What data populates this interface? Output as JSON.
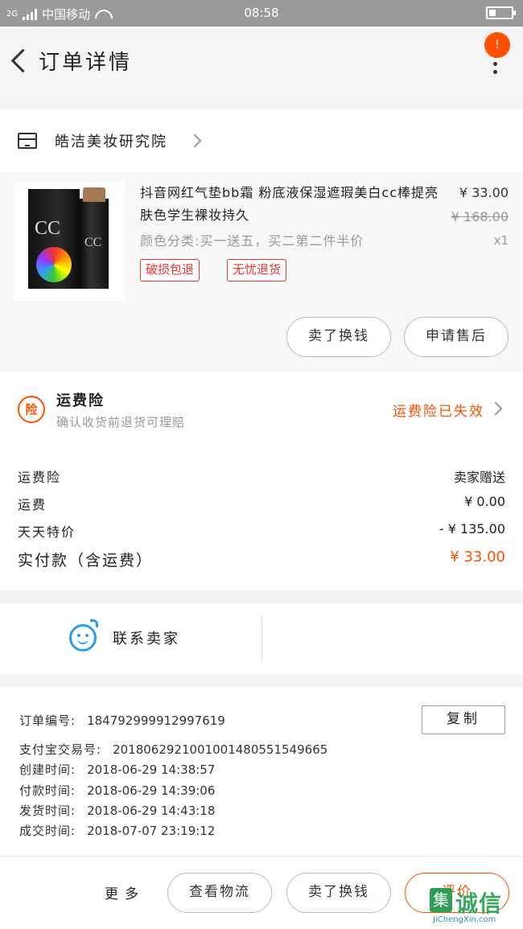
{
  "status_bar": {
    "network": "2G",
    "carrier": "中国移动",
    "time": "08:58"
  },
  "header": {
    "title": "订单详情",
    "badge": "!"
  },
  "shop": {
    "name": "皓洁美妆研究院"
  },
  "product": {
    "title": "抖音网红气垫bb霜 粉底液保湿遮瑕美白cc棒提亮肤色学生裸妆持久",
    "sku": "颜色分类:买一送五，买二第二件半价",
    "price": "¥ 33.00",
    "original_price": "¥ 168.00",
    "quantity": "x1",
    "tags": [
      "破损包退",
      "无忧退货"
    ],
    "image_text": "CC",
    "actions": [
      "卖了换钱",
      "申请售后"
    ]
  },
  "insurance": {
    "icon_text": "险",
    "title": "运费险",
    "subtitle": "确认收货前退货可理赔",
    "status": "运费险已失效"
  },
  "summary": {
    "rows": [
      {
        "label": "运费险",
        "value": "卖家赠送"
      },
      {
        "label": "运费",
        "value": "¥ 0.00"
      },
      {
        "label": "天天特价",
        "value": "- ¥ 135.00"
      }
    ],
    "paid_label": "实付款（含运费）",
    "paid_value": "¥ 33.00"
  },
  "contact": {
    "label": "联系卖家"
  },
  "order_info": {
    "copy_label": "复制",
    "rows": [
      {
        "label": "订单编号:",
        "value": "184792999912997619"
      },
      {
        "label": "支付宝交易号:",
        "value": "2018062921001001480551549665"
      },
      {
        "label": "创建时间:",
        "value": "2018-06-29 14:38:57"
      },
      {
        "label": "付款时间:",
        "value": "2018-06-29 14:39:06"
      },
      {
        "label": "发货时间:",
        "value": "2018-06-29 14:43:18"
      },
      {
        "label": "成交时间:",
        "value": "2018-07-07 23:19:12"
      }
    ]
  },
  "bottom_bar": {
    "more_label": "更多",
    "buttons": [
      "查看物流",
      "卖了换钱",
      "评价"
    ]
  },
  "watermark": {
    "logo": "集",
    "text": "诚信",
    "url": "JiChengXin.com"
  },
  "colors": {
    "accent": "#ff5000",
    "tag_red": "#e33333",
    "chat_blue": "#2b9bf4"
  }
}
